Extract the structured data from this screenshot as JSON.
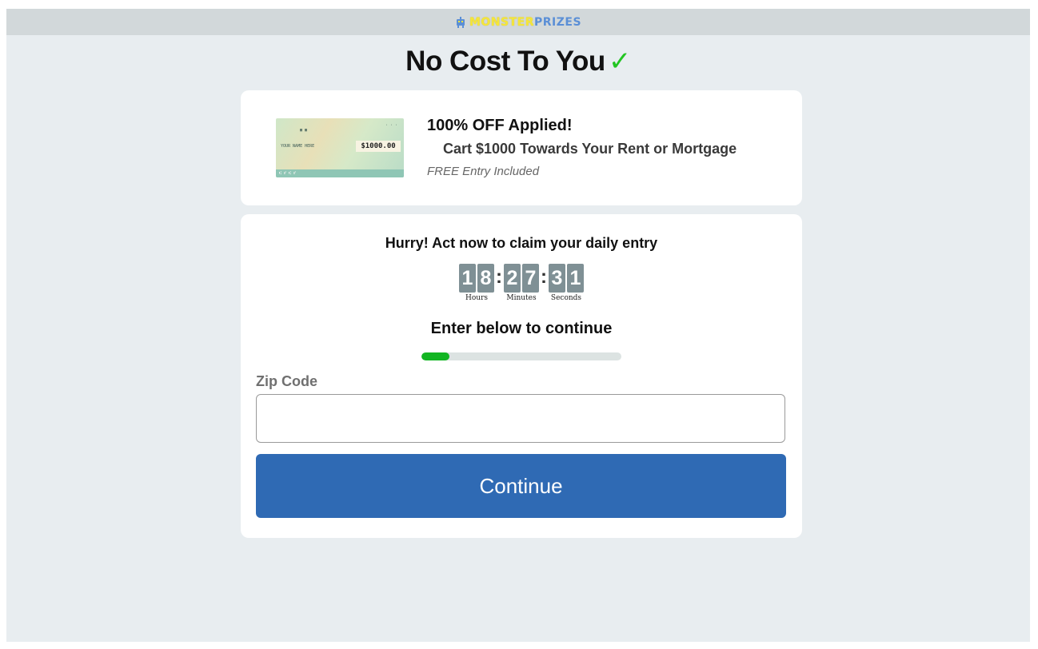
{
  "brand": {
    "logo_part1": "MONSTER",
    "logo_part2": "PRIZES",
    "icon": "robot-icon",
    "colors": {
      "part1": "#f5e63a",
      "part2": "#5b8fd6"
    }
  },
  "headline": {
    "text": "No Cost To You",
    "check_icon": "checkmark-icon",
    "check_glyph": "✓"
  },
  "offer": {
    "title": "100% OFF Applied!",
    "subtitle": "Cart $1000 Towards Your Rent or Mortgage",
    "note": "FREE Entry Included",
    "check_image": {
      "payee": "YOUR NAME HERE",
      "amount": "$1000.00"
    }
  },
  "countdown": {
    "heading": "Hurry! Act now to claim your daily entry",
    "hours": [
      "1",
      "8"
    ],
    "minutes": [
      "2",
      "7"
    ],
    "seconds": [
      "3",
      "1"
    ],
    "hours_label": "Hours",
    "minutes_label": "Minutes",
    "seconds_label": "Seconds",
    "separator": ":"
  },
  "form": {
    "instruction": "Enter below to continue",
    "progress_percent": 14,
    "zip_label": "Zip Code",
    "zip_value": "",
    "submit_label": "Continue"
  },
  "colors": {
    "accent_button": "#2f6ab4",
    "progress": "#12b522",
    "check": "#22c522",
    "background": "#e8edf0"
  }
}
